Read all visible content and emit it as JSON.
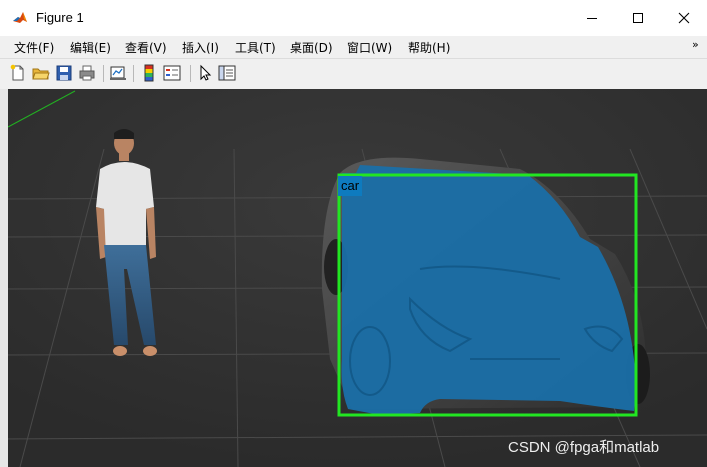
{
  "window": {
    "title": "Figure 1",
    "controls": {
      "minimize_icon": "minimize-icon",
      "maximize_icon": "maximize-icon",
      "close_icon": "close-icon"
    }
  },
  "menubar": {
    "items": [
      {
        "label": "文件(F)"
      },
      {
        "label": "编辑(E)"
      },
      {
        "label": "查看(V)"
      },
      {
        "label": "插入(I)"
      },
      {
        "label": "工具(T)"
      },
      {
        "label": "桌面(D)"
      },
      {
        "label": "窗口(W)"
      },
      {
        "label": "帮助(H)"
      }
    ],
    "overflow_icon": "double-arrow-icon"
  },
  "toolbar": {
    "icons": [
      "new-figure-icon",
      "open-file-icon",
      "save-icon",
      "print-icon",
      "link-plot-icon",
      "colorbar-icon",
      "legend-icon",
      "select-pointer-icon",
      "property-inspector-icon"
    ]
  },
  "figure": {
    "detection": {
      "label": "car",
      "box_color": "#22e622",
      "mask_color": "#1a6fa8"
    },
    "watermark": "CSDN @fpga和matlab",
    "background": "#313131"
  }
}
